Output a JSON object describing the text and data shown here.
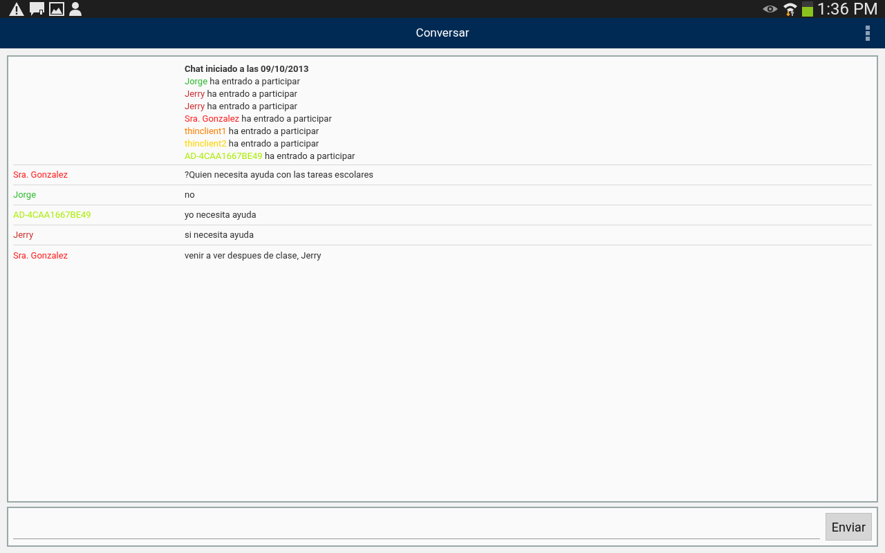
{
  "status_bar": {
    "time": "1:36 PM",
    "battery": {
      "level": 0.65
    }
  },
  "action_bar": {
    "title": "Conversar"
  },
  "chat": {
    "header": {
      "title": "Chat iniciado a las 09/10/2013",
      "joins": [
        {
          "name": "Jorge",
          "text": "ha entrado a participar",
          "color": "#33bb33"
        },
        {
          "name": "Jerry",
          "text": "ha entrado a participar",
          "color": "#cc3333"
        },
        {
          "name": "Jerry",
          "text": "ha entrado a participar",
          "color": "#cc3333"
        },
        {
          "name": "Sra. Gonzalez",
          "text": "ha entrado a participar",
          "color": "#ff2020"
        },
        {
          "name": "thinclient1",
          "text": "ha entrado a participar",
          "color": "#ff7f00"
        },
        {
          "name": "thinclient2",
          "text": "ha entrado a participar",
          "color": "#ffd500"
        },
        {
          "name": "AD-4CAA1667BE49",
          "text": "ha entrado a participar",
          "color": "#aaee00"
        }
      ]
    },
    "messages": [
      {
        "sender": "Sra. Gonzalez",
        "text": "?Quien necesita ayuda con las tareas escolares",
        "color": "#ff2020"
      },
      {
        "sender": "Jorge",
        "text": "no",
        "color": "#33bb33"
      },
      {
        "sender": "AD-4CAA1667BE49",
        "text": "yo necesita ayuda",
        "color": "#aaee00"
      },
      {
        "sender": "Jerry",
        "text": "si necesita ayuda",
        "color": "#cc3333"
      },
      {
        "sender": "Sra. Gonzalez",
        "text": "venir a ver despues de clase, Jerry",
        "color": "#ff2020"
      }
    ]
  },
  "composer": {
    "send_button": "Enviar"
  }
}
